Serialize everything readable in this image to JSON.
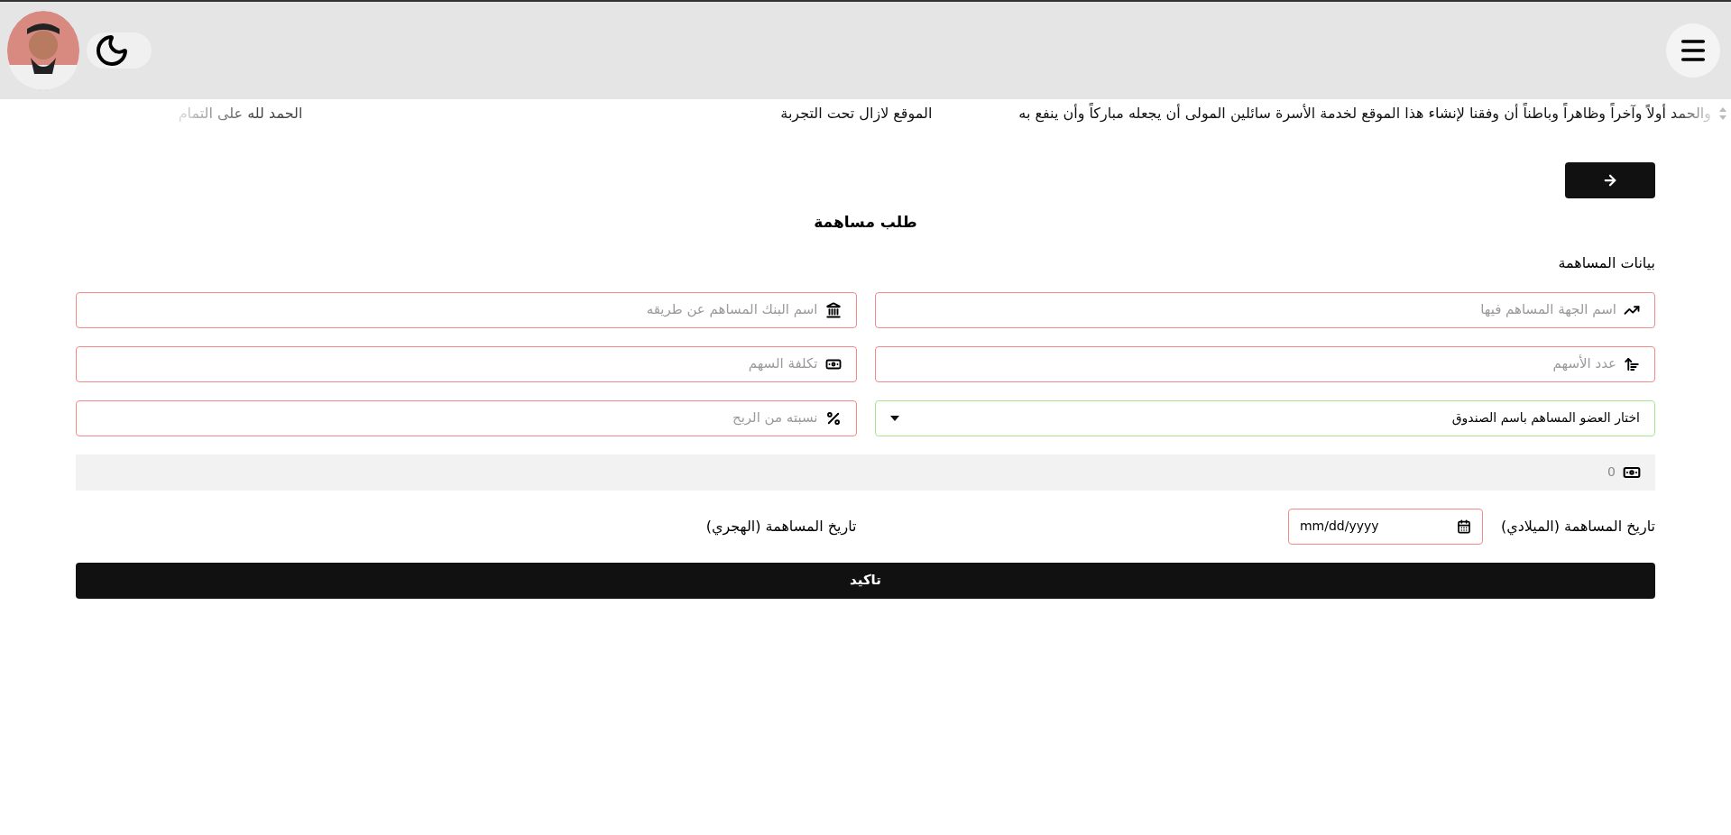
{
  "header": {
    "dark_mode": false
  },
  "ticker": [
    "والحمد أولاً وآخراً وظاهراً وباطناً أن وفقنا لإنشاء هذا الموقع لخدمة الأسرة سائلين المولى أن يجعله مباركاً وأن ينفع به",
    "الموقع لازال تحت التجربة",
    "الحمد لله على التمام"
  ],
  "form": {
    "title": "طلب مساهمة",
    "section": "بيانات المساهمة",
    "fields": [
      {
        "kind": "input",
        "placeholder": "اسم الجهة المساهم فيها",
        "valid": false
      },
      {
        "kind": "input",
        "placeholder": "اسم البنك المساهم عن طريقه",
        "valid": false
      },
      {
        "kind": "input",
        "placeholder": "عدد الأسهم",
        "valid": false
      },
      {
        "kind": "input",
        "placeholder": "تكلفة السهم",
        "valid": false
      },
      {
        "kind": "select",
        "value": "اختار العضو المساهم باسم الصندوق",
        "valid": true
      },
      {
        "kind": "input",
        "placeholder": "نسبته من الربح",
        "valid": false
      }
    ],
    "total": "0",
    "gregorian_date": {
      "label": "تاريخ المساهمة (الميلادي)",
      "placeholder": "mm/dd/yyyy",
      "valid": false
    },
    "hijri_date": {
      "label": "تاريخ المساهمة (الهجري)"
    },
    "submit": "تاكيد"
  }
}
